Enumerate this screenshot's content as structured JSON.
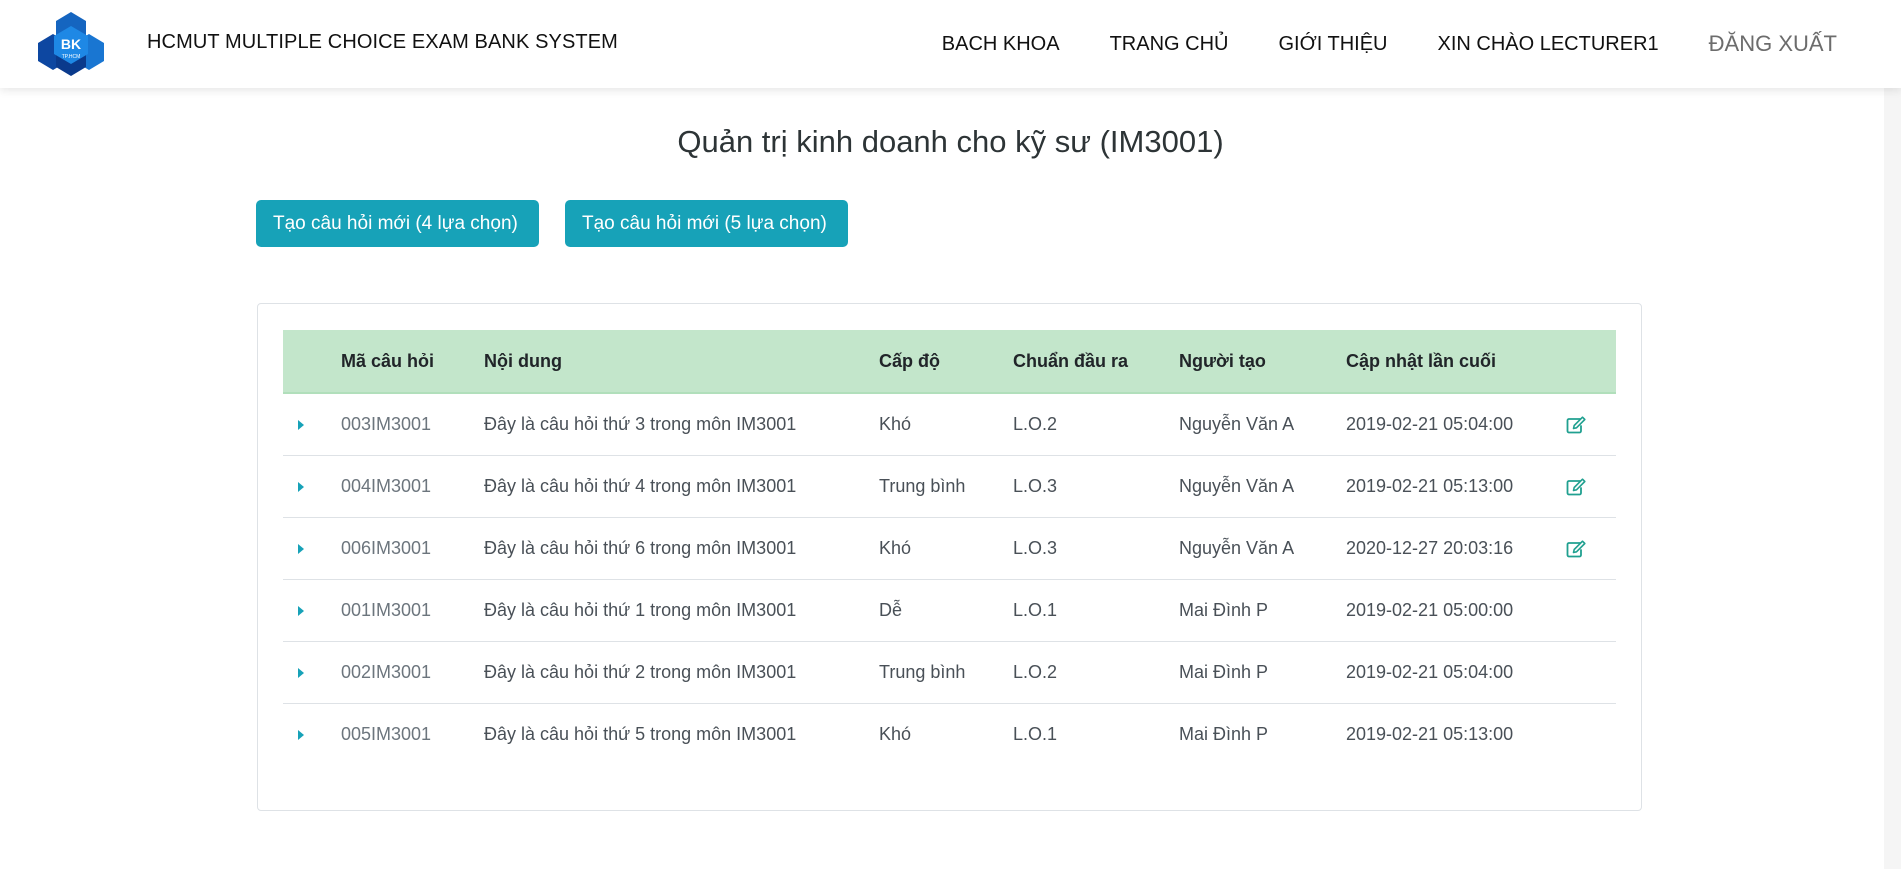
{
  "header": {
    "logo_text": "BK",
    "logo_subtext": "TP.HCM",
    "brand": "HCMUT MULTIPLE CHOICE EXAM BANK SYSTEM",
    "nav": [
      {
        "label": "BACH KHOA"
      },
      {
        "label": "TRANG CHỦ"
      },
      {
        "label": "GIỚI THIỆU"
      },
      {
        "label": "XIN CHÀO LECTURER1"
      },
      {
        "label": "ĐĂNG XUẤT"
      }
    ]
  },
  "page": {
    "title": "Quản trị kinh doanh cho kỹ sư (IM3001)",
    "btn_4": "Tạo câu hỏi mới (4 lựa chọn)",
    "btn_5": "Tạo câu hỏi mới (5 lựa chọn)"
  },
  "table": {
    "headers": {
      "code": "Mã câu hỏi",
      "content": "Nội dung",
      "level": "Cấp độ",
      "lo": "Chuẩn đầu ra",
      "creator": "Người tạo",
      "updated": "Cập nhật lần cuối"
    },
    "rows": [
      {
        "code": "003IM3001",
        "content": "Đây là câu hỏi thứ 3 trong môn IM3001",
        "level": "Khó",
        "lo": "L.O.2",
        "creator": "Nguyễn Văn A",
        "updated": "2019-02-21 05:04:00",
        "editable": true
      },
      {
        "code": "004IM3001",
        "content": "Đây là câu hỏi thứ 4 trong môn IM3001",
        "level": "Trung bình",
        "lo": "L.O.3",
        "creator": "Nguyễn Văn A",
        "updated": "2019-02-21 05:13:00",
        "editable": true
      },
      {
        "code": "006IM3001",
        "content": "Đây là câu hỏi thứ 6 trong môn IM3001",
        "level": "Khó",
        "lo": "L.O.3",
        "creator": "Nguyễn Văn A",
        "updated": "2020-12-27 20:03:16",
        "editable": true
      },
      {
        "code": "001IM3001",
        "content": "Đây là câu hỏi thứ 1 trong môn IM3001",
        "level": "Dễ",
        "lo": "L.O.1",
        "creator": "Mai Đình P",
        "updated": "2019-02-21 05:00:00",
        "editable": false
      },
      {
        "code": "002IM3001",
        "content": "Đây là câu hỏi thứ 2 trong môn IM3001",
        "level": "Trung bình",
        "lo": "L.O.2",
        "creator": "Mai Đình P",
        "updated": "2019-02-21 05:04:00",
        "editable": false
      },
      {
        "code": "005IM3001",
        "content": "Đây là câu hỏi thứ 5 trong môn IM3001",
        "level": "Khó",
        "lo": "L.O.1",
        "creator": "Mai Đình P",
        "updated": "2019-02-21 05:13:00",
        "editable": false
      }
    ]
  },
  "colors": {
    "primary": "#17a2b8",
    "header_row": "#c3e6cb",
    "edit_icon": "#20a090"
  },
  "icons": {
    "row_expand": "caret-right-icon",
    "row_edit": "edit-icon",
    "logo": "bk-logo-icon"
  }
}
